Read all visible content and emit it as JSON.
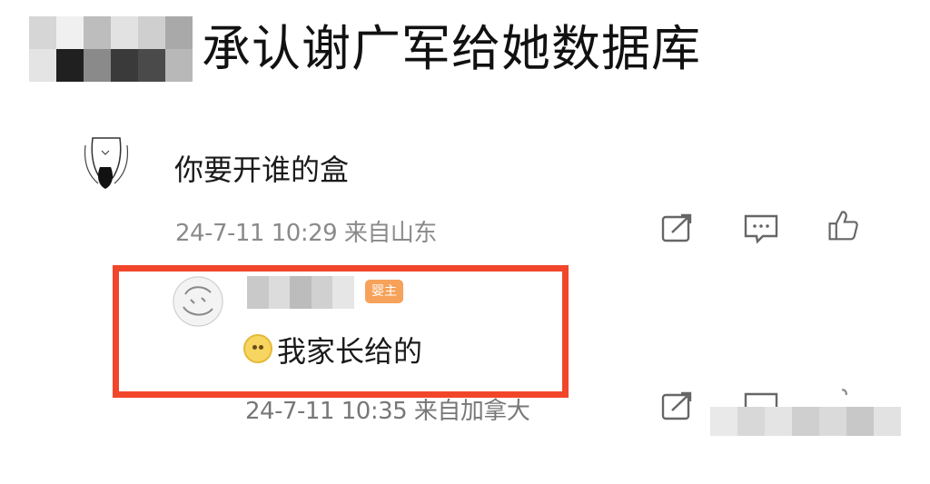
{
  "header": {
    "title": "承认谢广军给她数据库"
  },
  "comments": [
    {
      "text": "你要开谁的盒",
      "meta": "24-7-11 10:29 来自山东"
    }
  ],
  "reply": {
    "badge_text": "婴主",
    "text": "我家长给的",
    "meta": "24-7-11 10:35 来自加拿大"
  },
  "icons": {
    "share": "share-icon",
    "comment": "comment-icon",
    "like": "like-icon"
  },
  "colors": {
    "highlight": "#f2462b",
    "badge": "#f6a25a",
    "meta_text": "#8a8a8a"
  }
}
